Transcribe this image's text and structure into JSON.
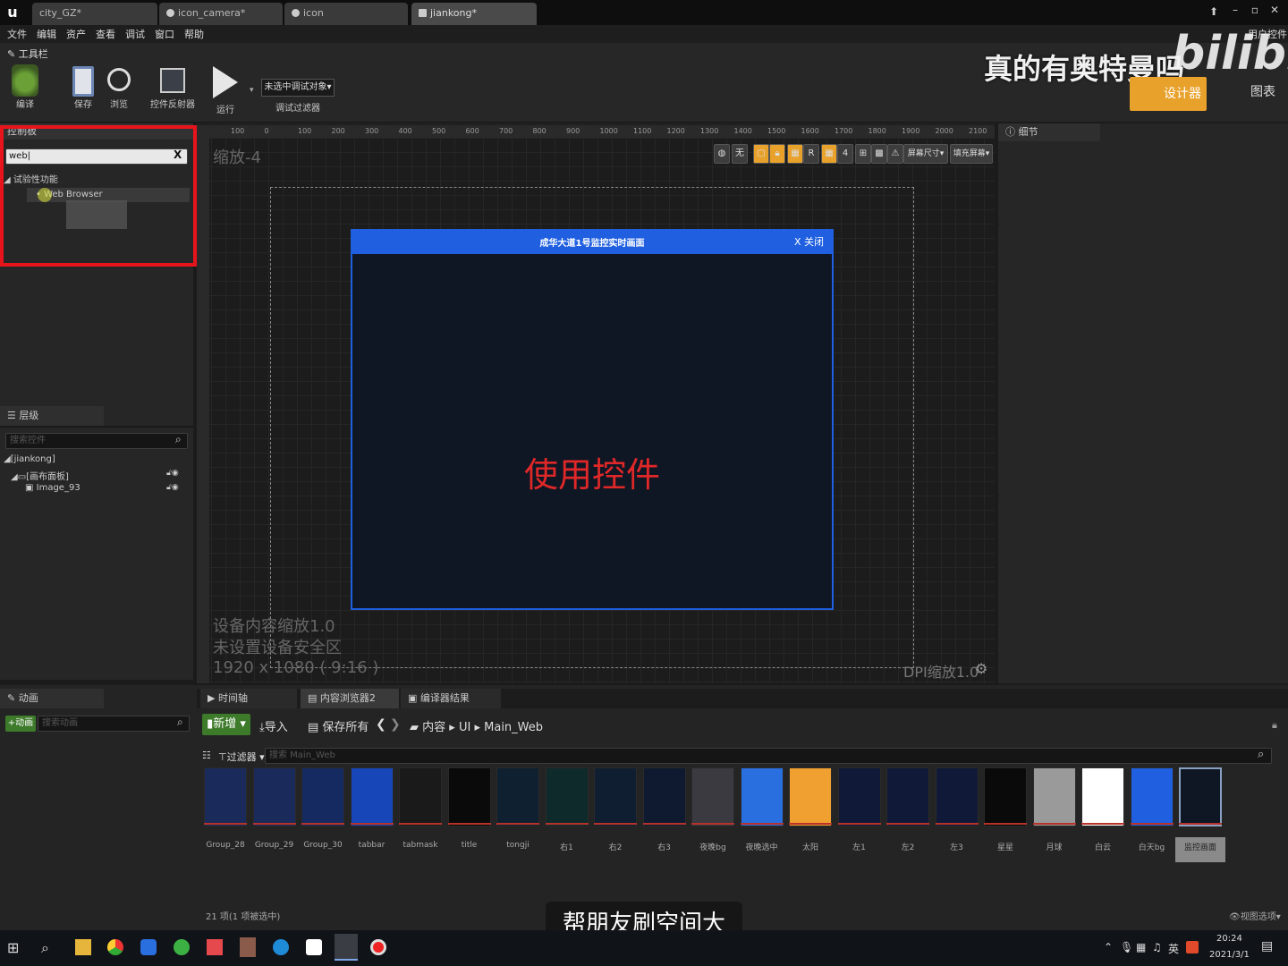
{
  "tabs": [
    {
      "label": "city_GZ*"
    },
    {
      "label": "icon_camera*"
    },
    {
      "label": "icon"
    },
    {
      "label": "jiankong*"
    }
  ],
  "window": {
    "min": "–",
    "restore": "▫",
    "close": "✕",
    "mode_label": "用户控件"
  },
  "menu": [
    "文件",
    "编辑",
    "资产",
    "查看",
    "调试",
    "窗口",
    "帮助"
  ],
  "toolbar": {
    "title": "工具栏",
    "compile": "编译",
    "save": "保存",
    "browse": "浏览",
    "reflector": "控件反射器",
    "run": "运行",
    "debug_object": "未选中调试对象▾",
    "debug_filter": "调试过滤器"
  },
  "mode": {
    "designer": "设计器",
    "graph": "图表"
  },
  "watermark": {
    "text": "真的有奥特曼吗",
    "brand": "bilibili"
  },
  "palette": {
    "header": "控制板",
    "search_value": "web|",
    "clear": "X",
    "category": "试验性功能",
    "item": "Web Browser"
  },
  "hierarchy": {
    "header": "层级",
    "search_placeholder": "搜索控件",
    "root": "[jiankong]",
    "canvas": "[画布面板]",
    "image": "Image_93"
  },
  "viewport": {
    "zoom": "缩放-4",
    "ruler": [
      "100",
      "0",
      "100",
      "200",
      "300",
      "400",
      "500",
      "600",
      "700",
      "800",
      "900",
      "1000",
      "1100",
      "1200",
      "1300",
      "1400",
      "1500",
      "1600",
      "1700",
      "1800",
      "1900",
      "2000",
      "2100"
    ],
    "screen_size": "屏幕尺寸▾",
    "fill_screen": "填充屏幕▾",
    "info1": "设备内容缩放1.0",
    "info2": "未设置设备安全区",
    "resolution": "1920 x 1080 ( 9:16 )",
    "dpi": "DPI缩放1.0",
    "btn_R": "R",
    "btn_4": "4",
    "btn_no": "无"
  },
  "popup": {
    "title": "成华大道1号监控实时画面",
    "close": "X 关闭"
  },
  "overlay_caption": "使用控件",
  "details": {
    "header": "细节"
  },
  "animation": {
    "header": "动画",
    "add": "+动画",
    "search_placeholder": "搜索动画"
  },
  "content_tabs": [
    "时间轴",
    "内容浏览器2",
    "编译器结果"
  ],
  "content": {
    "new": "新增 ▾",
    "import": "导入",
    "save_all": "保存所有",
    "path": [
      "内容",
      "UI",
      "Main_Web"
    ],
    "filter": "过滤器 ▾",
    "search_placeholder": "搜索 Main_Web",
    "count": "21 项(1 项被选中)",
    "view_options": "视图选项▾"
  },
  "assets": [
    "Group_28",
    "Group_29",
    "Group_30",
    "tabbar",
    "tabmask",
    "title",
    "tongji",
    "右1",
    "右2",
    "右3",
    "夜晚bg",
    "夜晚选中",
    "太阳",
    "左1",
    "左2",
    "左3",
    "星星",
    "月球",
    "白云",
    "白天bg",
    "监控画面"
  ],
  "subtitle": "帮朋友刷空间大",
  "taskbar": {
    "time": "20:24",
    "date": "2021/3/1",
    "ime": "英"
  },
  "colors": {
    "accent": "#e8a12a",
    "popup_bar": "#1f5fe0",
    "caption_red": "#e02828",
    "highlight_box": "#e8141c"
  }
}
